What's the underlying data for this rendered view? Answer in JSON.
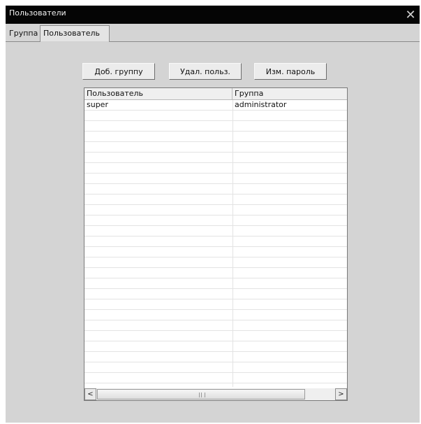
{
  "window": {
    "title": "Пользователи",
    "close_glyph": "✕"
  },
  "tabs": [
    {
      "label": "Группа"
    },
    {
      "label": "Пользователь"
    }
  ],
  "toolbar": {
    "add_group_label": "Доб. группу",
    "delete_user_label": "Удал. польз.",
    "change_password_label": "Изм. пароль"
  },
  "table": {
    "columns": [
      "Пользователь",
      "Группа"
    ],
    "rows": [
      [
        "super",
        "administrator"
      ]
    ]
  },
  "scrollbar": {
    "left_glyph": "<",
    "right_glyph": ">"
  },
  "colors": {
    "titlebar": "#050505",
    "window_bg": "#d4d4d4",
    "grid_bg": "#ffffff"
  }
}
